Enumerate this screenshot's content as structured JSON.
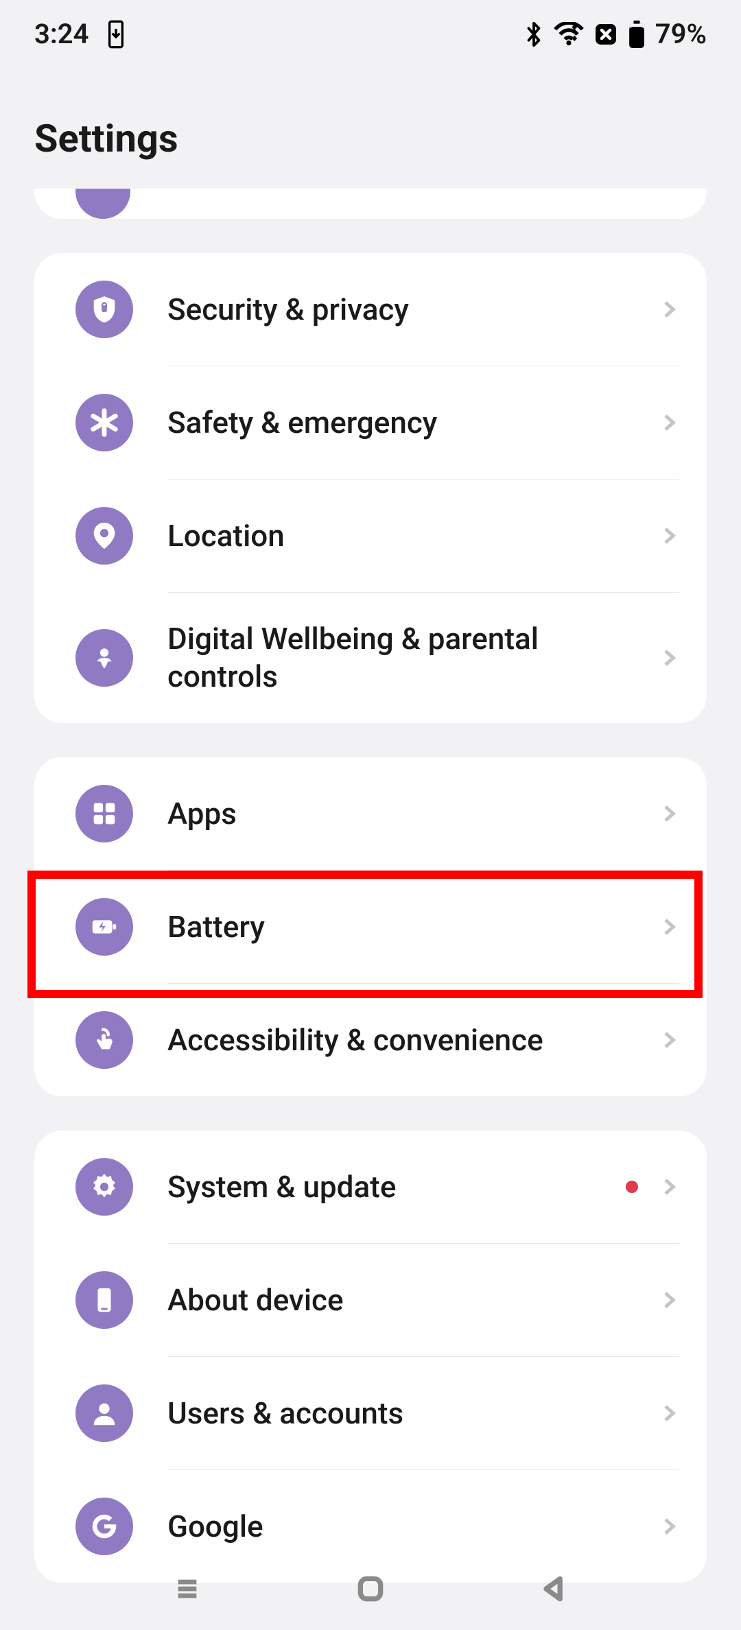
{
  "status": {
    "time": "3:24",
    "battery_pct": "79%"
  },
  "header": {
    "title": "Settings"
  },
  "groups": [
    {
      "items": [
        {
          "icon": "shield",
          "label": "Security & privacy"
        },
        {
          "icon": "asterisk",
          "label": "Safety & emergency"
        },
        {
          "icon": "pin",
          "label": "Location"
        },
        {
          "icon": "heart-person",
          "label": "Digital Wellbeing & parental controls"
        }
      ]
    },
    {
      "items": [
        {
          "icon": "grid",
          "label": "Apps"
        },
        {
          "icon": "battery",
          "label": "Battery",
          "highlighted": true
        },
        {
          "icon": "touch",
          "label": "Accessibility & convenience"
        }
      ]
    },
    {
      "items": [
        {
          "icon": "gear",
          "label": "System & update",
          "dot": true
        },
        {
          "icon": "phone",
          "label": "About device"
        },
        {
          "icon": "person",
          "label": "Users & accounts"
        },
        {
          "icon": "google",
          "label": "Google"
        }
      ]
    }
  ]
}
